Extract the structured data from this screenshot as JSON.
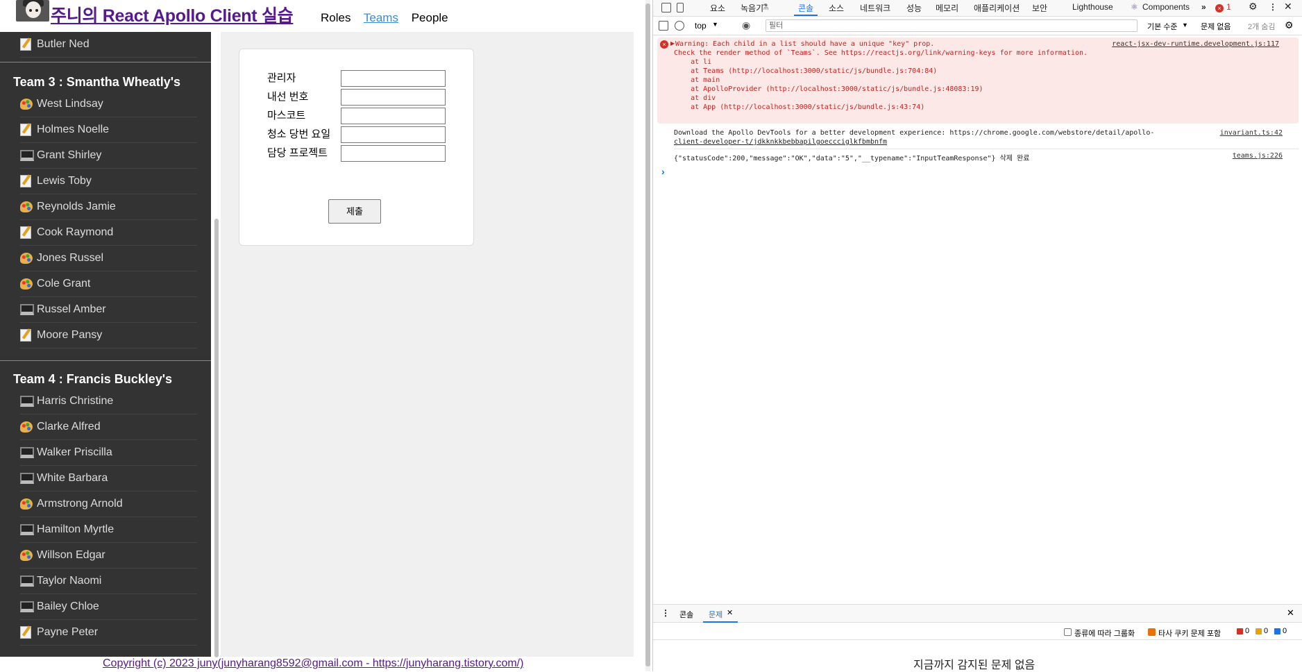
{
  "header": {
    "title": "주니의 React Apollo Client 실습",
    "nav": [
      "Roles",
      "Teams",
      "People"
    ],
    "active_nav": "Teams"
  },
  "sidebar": {
    "top_member": {
      "name": "Butler Ned",
      "icon": "memo-icon"
    },
    "teams": [
      {
        "title": "Team 3 : Smantha Wheatly's",
        "members": [
          {
            "name": "West Lindsay",
            "icon": "palette-icon"
          },
          {
            "name": "Holmes Noelle",
            "icon": "memo-icon"
          },
          {
            "name": "Grant Shirley",
            "icon": "laptop-icon"
          },
          {
            "name": "Lewis Toby",
            "icon": "memo-icon"
          },
          {
            "name": "Reynolds Jamie",
            "icon": "palette-icon"
          },
          {
            "name": "Cook Raymond",
            "icon": "memo-icon"
          },
          {
            "name": "Jones Russel",
            "icon": "palette-icon"
          },
          {
            "name": "Cole Grant",
            "icon": "palette-icon"
          },
          {
            "name": "Russel Amber",
            "icon": "laptop-icon"
          },
          {
            "name": "Moore Pansy",
            "icon": "memo-icon"
          }
        ]
      },
      {
        "title": "Team 4 : Francis Buckley's",
        "members": [
          {
            "name": "Harris Christine",
            "icon": "laptop-icon"
          },
          {
            "name": "Clarke Alfred",
            "icon": "palette-icon"
          },
          {
            "name": "Walker Priscilla",
            "icon": "laptop-icon"
          },
          {
            "name": "White Barbara",
            "icon": "laptop-icon"
          },
          {
            "name": "Armstrong Arnold",
            "icon": "palette-icon"
          },
          {
            "name": "Hamilton Myrtle",
            "icon": "laptop-icon"
          },
          {
            "name": "Willson Edgar",
            "icon": "palette-icon"
          },
          {
            "name": "Taylor Naomi",
            "icon": "laptop-icon"
          },
          {
            "name": "Bailey Chloe",
            "icon": "laptop-icon"
          },
          {
            "name": "Payne Peter",
            "icon": "memo-icon"
          }
        ]
      }
    ]
  },
  "form": {
    "fields": [
      {
        "label": "관리자",
        "value": ""
      },
      {
        "label": "내선 번호",
        "value": ""
      },
      {
        "label": "마스코트",
        "value": ""
      },
      {
        "label": "청소 당번 요일",
        "value": ""
      },
      {
        "label": "담당 프로젝트",
        "value": ""
      }
    ],
    "submit_label": "제출"
  },
  "footer": {
    "text": "Copyright (c) 2023 juny(junyharang8592@gmail.com - https://junyharang.tistory.com/)"
  },
  "devtools": {
    "tabs": [
      "요소",
      "녹음기",
      "콘솔",
      "소스",
      "네트워크",
      "성능",
      "메모리",
      "애플리케이션",
      "보안",
      "Lighthouse",
      "Components"
    ],
    "selected_tab": "콘솔",
    "error_count": "1",
    "context": "top",
    "filter_placeholder": "필터",
    "log_level": "기본 수준",
    "issues_status": "문제 없음",
    "hidden_count": "2개 숨김",
    "error_message": {
      "lines": [
        "Warning: Each child in a list should have a unique \"key\" prop.",
        "Check the render method of `Teams`. See https://reactjs.org/link/warning-keys for more information.",
        "    at li",
        "    at Teams (http://localhost:3000/static/js/bundle.js:704:84)",
        "    at main",
        "    at ApolloProvider (http://localhost:3000/static/js/bundle.js:48083:19)",
        "    at div",
        "    at App (http://localhost:3000/static/js/bundle.js:43:74)"
      ],
      "source": "react-jsx-dev-runtime.development.js:117"
    },
    "info_message": {
      "lines": [
        "Download the Apollo DevTools for a better development experience: https://chrome.google.com/webstore/detail/apollo-",
        "client-developer-t/jdkknkkbebbapilgoeccciglkfbmbnfm"
      ],
      "source": "invariant.ts:42"
    },
    "log_message": {
      "text": "{\"statusCode\":200,\"message\":\"OK\",\"data\":\"5\",\"__typename\":\"InputTeamResponse\"} 삭제 완료",
      "source": "teams.js:226"
    },
    "prompt": "›",
    "drawer": {
      "tabs": [
        "콘솔",
        "문제"
      ],
      "selected": "문제",
      "group_label": "종류에 따라 그룹화",
      "third_party_label": "타사 쿠키 문제 포함",
      "counts": [
        "0",
        "0",
        "0"
      ],
      "empty_message": "지금까지 감지된 문제 없음"
    }
  }
}
